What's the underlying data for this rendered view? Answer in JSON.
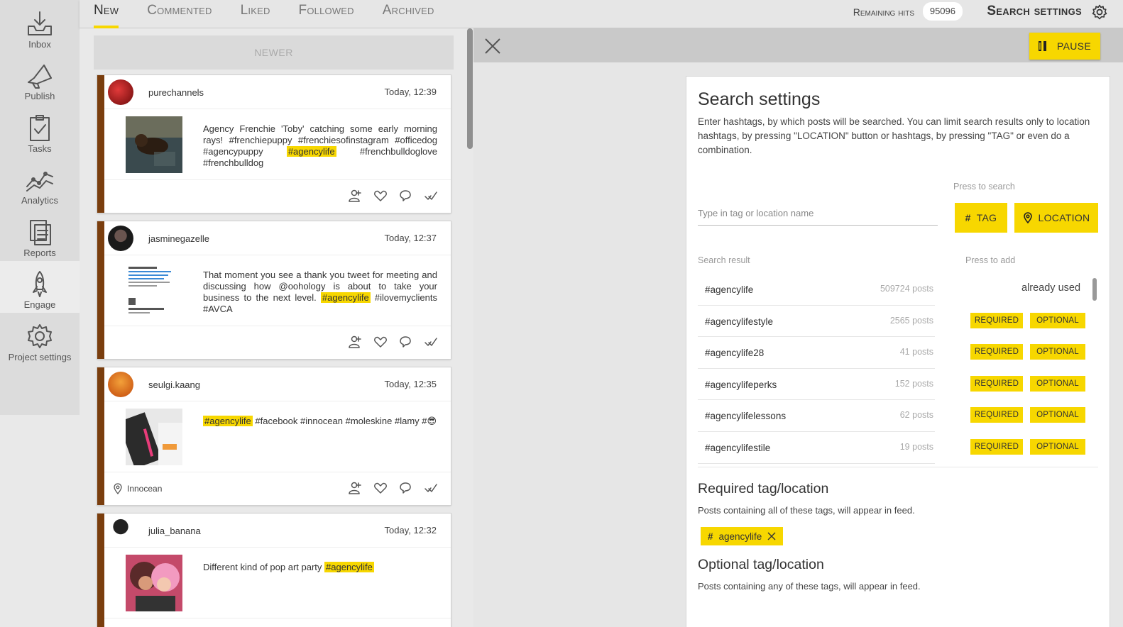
{
  "sidebar": {
    "items": [
      {
        "label": "Inbox",
        "icon": "inbox-icon"
      },
      {
        "label": "Publish",
        "icon": "megaphone-icon"
      },
      {
        "label": "Tasks",
        "icon": "clipboard-check-icon"
      },
      {
        "label": "Analytics",
        "icon": "analytics-chart-icon"
      },
      {
        "label": "Reports",
        "icon": "reports-icon"
      },
      {
        "label": "Engage",
        "icon": "rocket-icon"
      },
      {
        "label": "Project settings",
        "icon": "gear-icon"
      }
    ]
  },
  "topbar": {
    "tabs": [
      {
        "label": "New"
      },
      {
        "label": "Commented"
      },
      {
        "label": "Liked"
      },
      {
        "label": "Followed"
      },
      {
        "label": "Archived"
      }
    ],
    "remaining_hits_label": "Remaining hits",
    "remaining_hits_value": "95096",
    "search_settings_label": "Search settings"
  },
  "feed": {
    "newer_label": "NEWER",
    "posts": [
      {
        "username": "purechannels",
        "time": "Today, 12:39",
        "caption_before": "Agency Frenchie 'Toby' catching some early morning rays! #frenchiepuppy #frenchiesofinstagram #officedog #agencypuppy ",
        "caption_hl": "#agencylife",
        "caption_after": " #frenchbulldoglove #frenchbulldog",
        "location": ""
      },
      {
        "username": "jasminegazelle",
        "time": "Today, 12:37",
        "caption_before": "That moment you see a thank you tweet for meeting and discussing how @oohology is about to take your business to the next level. ",
        "caption_hl": "#agencylife",
        "caption_after": " #ilovemyclients #AVCA",
        "location": ""
      },
      {
        "username": "seulgi.kaang",
        "time": "Today, 12:35",
        "caption_before": "",
        "caption_hl": "#agencylife",
        "caption_after": " #facebook #innocean #moleskine #lamy #😎",
        "location": "Innocean"
      },
      {
        "username": "julia_banana",
        "time": "Today, 12:32",
        "caption_before": "Different kind of pop art party ",
        "caption_hl": "#agencylife",
        "caption_after": "",
        "location": ""
      }
    ]
  },
  "panel": {
    "pause_label": "PAUSE",
    "title": "Search settings",
    "description": "Enter hashtags, by which posts will be searched. You can limit search results only to location hashtags, by pressing \"LOCATION\" button or hashtags, by pressing \"TAG\" or even do a combination.",
    "press_to_search": "Press to search",
    "input_placeholder": "Type in tag or location name",
    "tag_button": "TAG",
    "location_button": "LOCATION",
    "search_result_label": "Search result",
    "press_to_add_label": "Press to add",
    "required_btn": "REQUIRED",
    "optional_btn": "OPTIONAL",
    "results": [
      {
        "tag": "#agencylife",
        "count": "509724 posts",
        "status": "already used"
      },
      {
        "tag": "#agencylifestyle",
        "count": "2565 posts",
        "status": ""
      },
      {
        "tag": "#agencylife28",
        "count": "41 posts",
        "status": ""
      },
      {
        "tag": "#agencylifeperks",
        "count": "152 posts",
        "status": ""
      },
      {
        "tag": "#agencylifelessons",
        "count": "62 posts",
        "status": ""
      },
      {
        "tag": "#agencylifestile",
        "count": "19 posts",
        "status": ""
      }
    ],
    "required_title": "Required tag/location",
    "required_desc": "Posts containing all of these tags, will appear in feed.",
    "required_chip": "agencylife",
    "optional_title": "Optional tag/location",
    "optional_desc": "Posts containing any of these tags, will appear in feed."
  },
  "colors": {
    "accent": "#f7d700",
    "card_border": "#7a3e0e"
  }
}
